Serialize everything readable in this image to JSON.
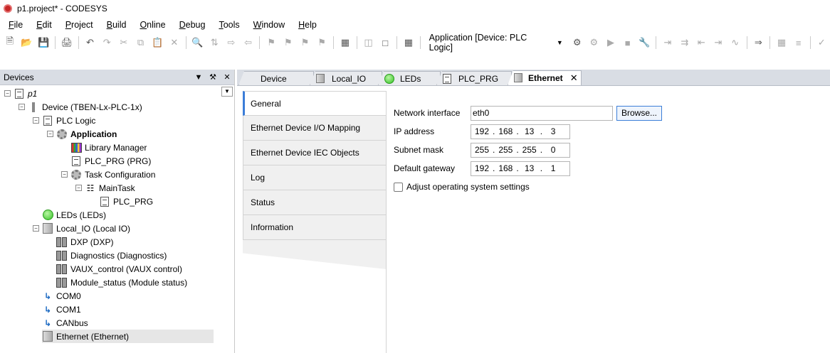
{
  "window": {
    "title": "p1.project* - CODESYS"
  },
  "menu": [
    {
      "label": "File",
      "key": "F",
      "rest": "ile"
    },
    {
      "label": "Edit",
      "key": "E",
      "rest": "dit"
    },
    {
      "label": "Project",
      "key": "P",
      "rest": "roject"
    },
    {
      "label": "Build",
      "key": "B",
      "rest": "uild"
    },
    {
      "label": "Online",
      "key": "O",
      "rest": "nline"
    },
    {
      "label": "Debug",
      "key": "D",
      "rest": "ebug"
    },
    {
      "label": "Tools",
      "key": "T",
      "rest": "ools"
    },
    {
      "label": "Window",
      "key": "W",
      "rest": "indow"
    },
    {
      "label": "Help",
      "key": "H",
      "rest": "elp"
    }
  ],
  "toolbar": {
    "active_application": "Application [Device: PLC Logic]"
  },
  "devices_panel": {
    "title": "Devices",
    "tree": [
      {
        "label": "p1",
        "italic": true
      },
      {
        "label": "Device (TBEN-Lx-PLC-1x)"
      },
      {
        "label": "PLC Logic"
      },
      {
        "label": "Application",
        "bold": true
      },
      {
        "label": "Library Manager"
      },
      {
        "label": "PLC_PRG (PRG)"
      },
      {
        "label": "Task Configuration"
      },
      {
        "label": "MainTask"
      },
      {
        "label": "PLC_PRG"
      },
      {
        "label": "LEDs (LEDs)"
      },
      {
        "label": "Local_IO (Local IO)"
      },
      {
        "label": "DXP (DXP)"
      },
      {
        "label": "Diagnostics (Diagnostics)"
      },
      {
        "label": "VAUX_control (VAUX control)"
      },
      {
        "label": "Module_status (Module status)"
      },
      {
        "label": "COM0"
      },
      {
        "label": "COM1"
      },
      {
        "label": "CANbus"
      },
      {
        "label": "Ethernet (Ethernet)",
        "selected": true
      }
    ]
  },
  "editor_tabs": [
    {
      "label": "Device"
    },
    {
      "label": "Local_IO"
    },
    {
      "label": "LEDs"
    },
    {
      "label": "PLC_PRG"
    },
    {
      "label": "Ethernet",
      "active": true
    }
  ],
  "subtabs": [
    {
      "label": "General",
      "active": true
    },
    {
      "label": "Ethernet Device I/O Mapping"
    },
    {
      "label": "Ethernet Device IEC Objects"
    },
    {
      "label": "Log"
    },
    {
      "label": "Status"
    },
    {
      "label": "Information"
    }
  ],
  "general": {
    "network_interface_label": "Network interface",
    "network_interface_value": "eth0",
    "browse_label": "Browse...",
    "ip_address_label": "IP address",
    "ip_address": [
      "192",
      "168",
      "13",
      "3"
    ],
    "subnet_mask_label": "Subnet mask",
    "subnet_mask": [
      "255",
      "255",
      "255",
      "0"
    ],
    "default_gateway_label": "Default gateway",
    "default_gateway": [
      "192",
      "168",
      "13",
      "1"
    ],
    "adjust_os_label": "Adjust operating system settings",
    "adjust_os_checked": false
  }
}
